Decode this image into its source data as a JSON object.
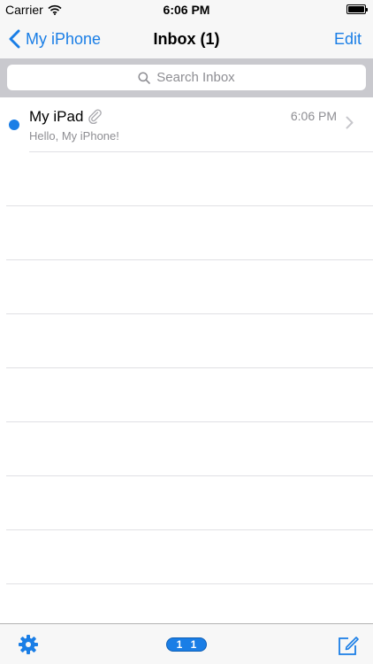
{
  "status_bar": {
    "carrier": "Carrier",
    "time": "6:06 PM",
    "icons": [
      "wifi-icon",
      "battery-icon"
    ]
  },
  "nav_bar": {
    "back_label": "My iPhone",
    "title": "Inbox (1)",
    "edit_label": "Edit"
  },
  "search": {
    "placeholder": "Search Inbox"
  },
  "messages": [
    {
      "sender": "My iPad",
      "time": "6:06 PM",
      "preview": "Hello, My iPhone!",
      "unread": true,
      "has_attachment": true
    }
  ],
  "toolbar": {
    "badge_left": "1",
    "badge_right": "1"
  },
  "colors": {
    "accent": "#1a7ee6",
    "secondary_text": "#8e8e93",
    "bar_background": "#f7f7f7",
    "search_background": "#c9c9ce"
  }
}
